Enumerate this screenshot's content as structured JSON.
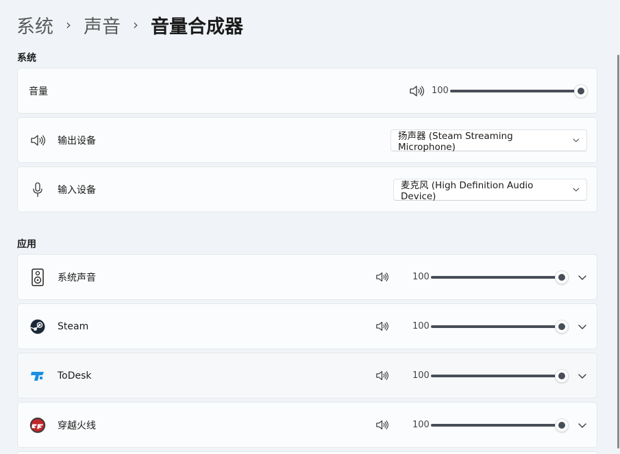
{
  "breadcrumb": {
    "item1": "系统",
    "item2": "声音",
    "current": "音量合成器"
  },
  "system_section": {
    "title": "系统",
    "volume": {
      "label": "音量",
      "value": "100",
      "level": 100
    },
    "output": {
      "label": "输出设备",
      "selected": "扬声器 (Steam Streaming Microphone)"
    },
    "input": {
      "label": "输入设备",
      "selected": "麦克风 (High Definition Audio Device)"
    }
  },
  "apps_section": {
    "title": "应用",
    "apps": [
      {
        "name": "系统声音",
        "value": "100",
        "level": 100,
        "icon": "speaker-device-icon"
      },
      {
        "name": "Steam",
        "value": "100",
        "level": 100,
        "icon": "steam-icon"
      },
      {
        "name": "ToDesk",
        "value": "100",
        "level": 100,
        "icon": "todesk-icon"
      },
      {
        "name": "穿越火线",
        "value": "100",
        "level": 100,
        "icon": "crossfire-icon"
      }
    ]
  },
  "colors": {
    "accent": "#474e57",
    "background": "#f0f4f8",
    "card": "#fbfcfd",
    "todesk": "#1a8fe3",
    "crossfire": "#c0282c"
  }
}
